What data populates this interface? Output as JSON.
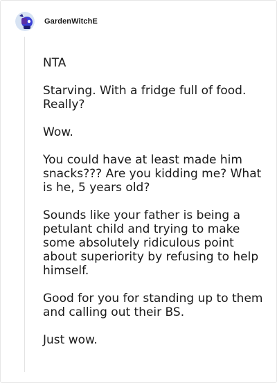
{
  "comment": {
    "author": "GardenWitchE",
    "paragraphs": [
      "NTA",
      "Starving. With a fridge full of food. Really?",
      "Wow.",
      "You could have at least made him snacks??? Are you kidding me? What is he, 5 years old?",
      "Sounds like your father is being a petulant child and trying to make some absolutely ridiculous point about superiority by refusing to help himself.",
      "Good for you for standing up to them and calling out their BS.",
      "Just wow."
    ]
  },
  "colors": {
    "avatar_bg": "#cfe0f2",
    "avatar_figure": "#3b3fd6",
    "text": "#1a1a1a",
    "thread_line": "#e3e3e3"
  },
  "icons": {
    "avatar": "user-avatar-icon"
  }
}
